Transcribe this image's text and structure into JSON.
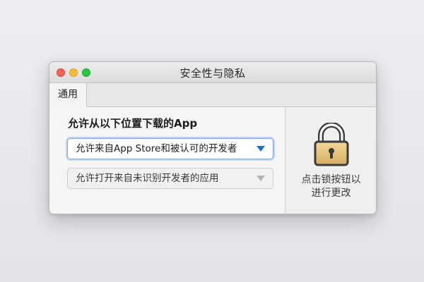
{
  "window": {
    "title": "安全性与隐私"
  },
  "tabs": [
    {
      "label": "通用"
    }
  ],
  "general": {
    "section_title": "允许从以下位置下载的App",
    "dropdown_primary": "允许来自App Store和被认可的开发者",
    "dropdown_secondary": "允许打开来自未识别开发者的应用"
  },
  "lock": {
    "text_line1": "点击锁按钮以",
    "text_line2": "进行更改"
  },
  "colors": {
    "accent": "#1a6fe0",
    "close": "#fe5f57",
    "minimize": "#febc2e",
    "zoom": "#28c840"
  },
  "icons": [
    "close-icon",
    "minimize-icon",
    "zoom-icon",
    "dropdown-arrow-icon",
    "lock-icon"
  ]
}
